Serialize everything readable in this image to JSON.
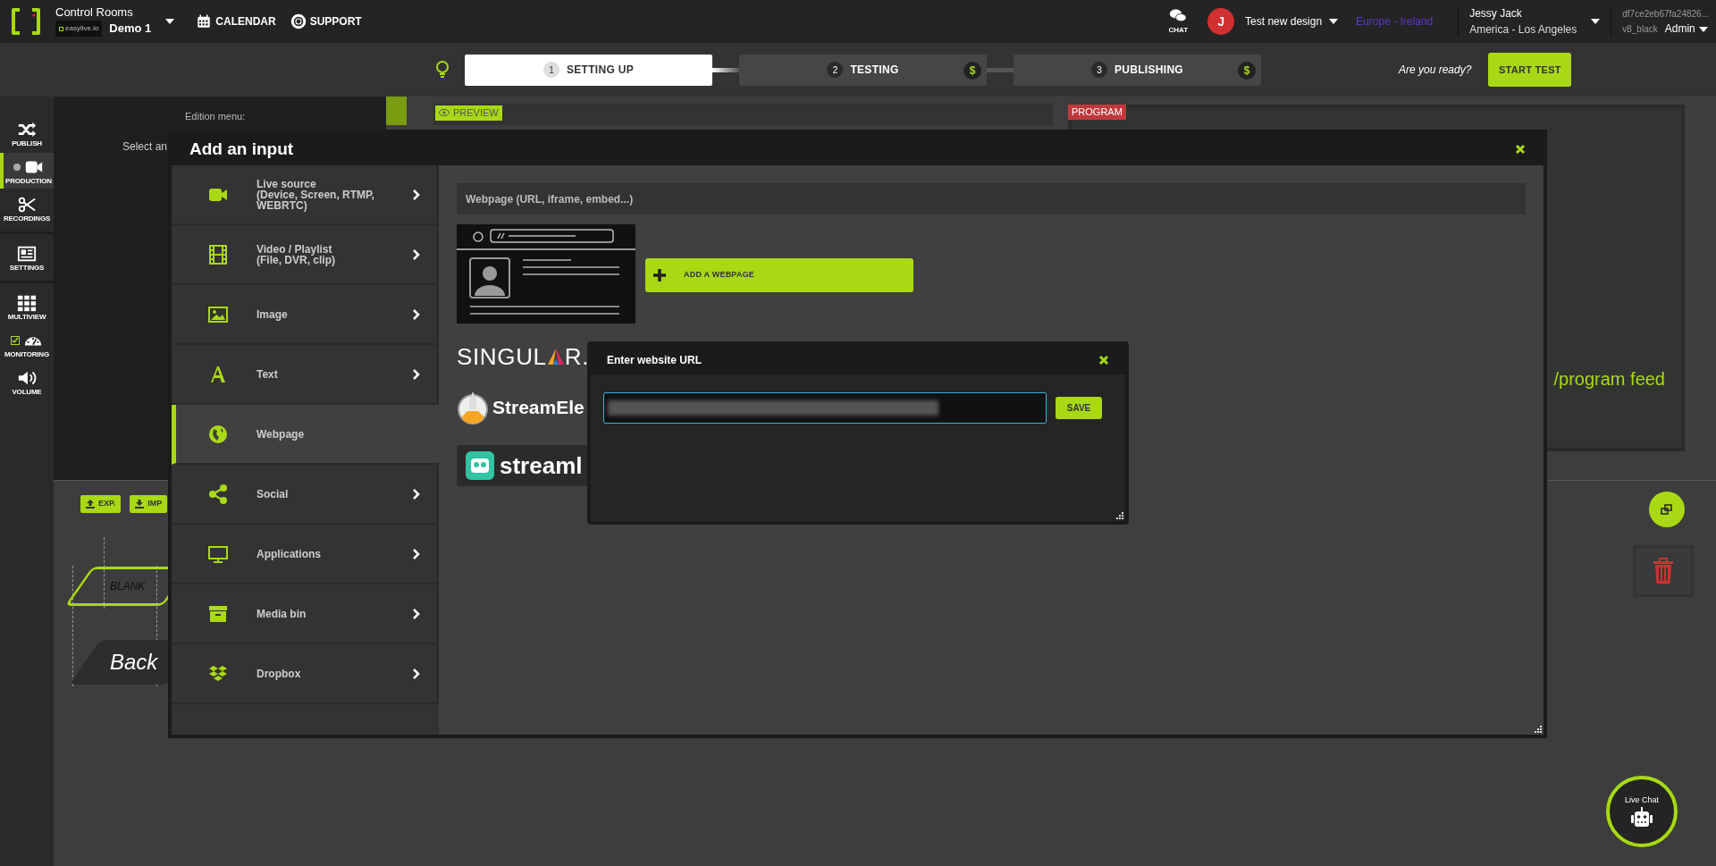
{
  "header": {
    "app_title": "Control Rooms",
    "org_logo_text": "easylive.io",
    "room": "Demo 1",
    "nav": [
      {
        "label": "CALENDAR"
      },
      {
        "label": "SUPPORT"
      }
    ],
    "chat_label": "CHAT",
    "avatar_initial": "J",
    "project": "Test new design",
    "region": "Europe - Ireland",
    "user_name": "Jessy Jack",
    "user_timezone": "America - Los Angeles",
    "session_id": "df7ce2eb67fa24826...",
    "theme": "v8_black",
    "role": "Admin"
  },
  "steps": [
    {
      "number": "1",
      "label": "SETTING UP",
      "selected": true
    },
    {
      "number": "2",
      "label": "TESTING",
      "selected": false,
      "badge": "$"
    },
    {
      "number": "3",
      "label": "PUBLISHING",
      "selected": false,
      "badge": "$"
    }
  ],
  "ready_prompt": "Are you ready?",
  "start_button": "START TEST",
  "sidebar": [
    [
      {
        "label": "PUBLISH",
        "kind": "plain",
        "selected": false
      },
      {
        "label": "PRODUCTION",
        "kind": "status",
        "selected": true
      },
      {
        "label": "RECORDINGS",
        "kind": "plain",
        "selected": false
      }
    ],
    [
      {
        "label": "SETTINGS",
        "kind": "plain",
        "selected": false
      }
    ],
    [
      {
        "label": "MULTIVIEW",
        "kind": "plain",
        "selected": false
      },
      {
        "label": "MONITORING",
        "kind": "toggle",
        "selected": false,
        "checked": true
      },
      {
        "label": "VOLUME",
        "kind": "plain",
        "selected": false
      }
    ]
  ],
  "workspace": {
    "edition_label": "Edition menu:",
    "select_text": "Select an",
    "preview_label": "PREVIEW",
    "program_label": "PROGRAM",
    "program_feed_text": "/program feed",
    "export_button": "EXP.",
    "import_button": "IMP",
    "blank_label": "BLANK",
    "back_label": "Back",
    "live_chat": "Live Chat"
  },
  "modal": {
    "title": "Add an input",
    "categories": [
      {
        "label": "Live source",
        "sublabel": "(Device, Screen, RTMP, WEBRTC)",
        "selected": false
      },
      {
        "label": "Video / Playlist",
        "sublabel": "(File, DVR, clip)",
        "selected": false
      },
      {
        "label": "Image",
        "selected": false
      },
      {
        "label": "Text",
        "selected": false
      },
      {
        "label": "Webpage",
        "selected": true
      },
      {
        "label": "Social",
        "selected": false
      },
      {
        "label": "Applications",
        "selected": false
      },
      {
        "label": "Media bin",
        "selected": false
      },
      {
        "label": "Dropbox",
        "selected": false
      }
    ],
    "section_title": "Webpage (URL, iframe, embed...)",
    "add_button": "ADD A WEBPAGE",
    "integrations": [
      {
        "kind": "singular",
        "name_start": "SINGUL",
        "name_end": "R."
      },
      {
        "kind": "streamelements",
        "name": "StreamEle"
      },
      {
        "kind": "streamlabs",
        "name": "streaml"
      }
    ]
  },
  "url_dialog": {
    "title": "Enter website URL",
    "save_button": "SAVE"
  }
}
